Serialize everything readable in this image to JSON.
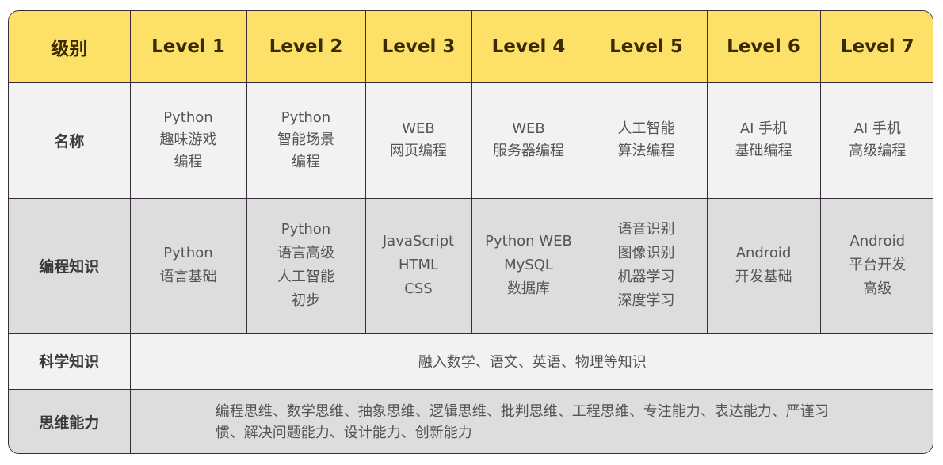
{
  "header": {
    "label": "级别",
    "levels": [
      "Level 1",
      "Level 2",
      "Level 3",
      "Level 4",
      "Level 5",
      "Level 6",
      "Level 7"
    ]
  },
  "rows": {
    "name": {
      "label": "名称",
      "cells": [
        "Python\n趣味游戏\n编程",
        "Python\n智能场景\n编程",
        "WEB\n网页编程",
        "WEB\n服务器编程",
        "人工智能\n算法编程",
        "AI 手机\n基础编程",
        "AI 手机\n高级编程"
      ]
    },
    "coding": {
      "label": "编程知识",
      "cells": [
        "Python\n语言基础",
        "Python\n语言高级\n人工智能\n初步",
        "JavaScript\nHTML\nCSS",
        "Python WEB\nMySQL\n数据库",
        "语音识别\n图像识别\n机器学习\n深度学习",
        "Android\n开发基础",
        "Android\n平台开发\n高级"
      ]
    },
    "science": {
      "label": "科学知识",
      "value": "融入数学、语文、英语、物理等知识"
    },
    "thinking": {
      "label": "思维能力",
      "value": "编程思维、数学思维、抽象思维、逻辑思维、批判思维、工程思维、专注能力、表达能力、严谨习惯、解决问题能力、设计能力、创新能力"
    }
  }
}
